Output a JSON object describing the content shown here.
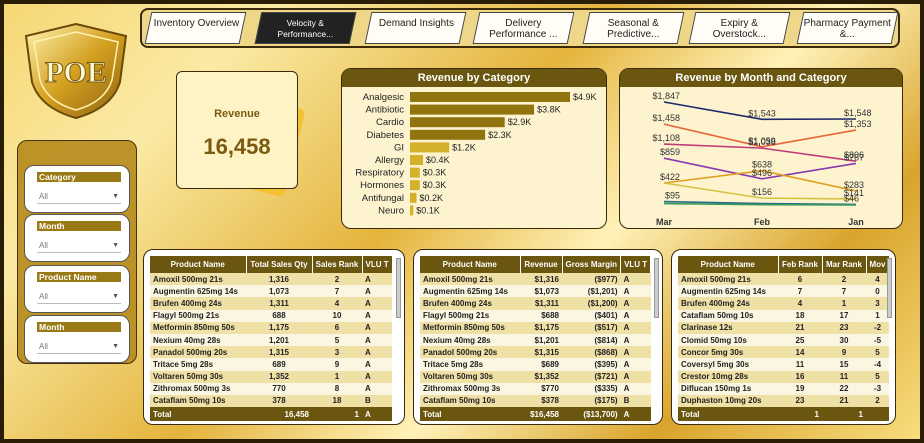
{
  "logo_text": "POE",
  "nav": [
    {
      "label": "Inventory Overview",
      "active": false
    },
    {
      "label": "Velocity & Performance...",
      "active": true
    },
    {
      "label": "Demand Insights",
      "active": false
    },
    {
      "label": "Delivery Performance ...",
      "active": false
    },
    {
      "label": "Seasonal & Predictive...",
      "active": false
    },
    {
      "label": "Expiry & Overstock...",
      "active": false
    },
    {
      "label": "Pharmacy Payment &...",
      "active": false
    }
  ],
  "revenue_card": {
    "label": "Revenue",
    "value": "16,458"
  },
  "slicers": [
    {
      "title": "Category",
      "value": "All"
    },
    {
      "title": "Month",
      "value": "All"
    },
    {
      "title": "Product Name",
      "value": "All"
    },
    {
      "title": "Month",
      "value": "All"
    }
  ],
  "colors": {
    "bar": "#8f7410",
    "bar_light": "#d4b12a",
    "header": "#6b560f"
  },
  "chart_data": [
    {
      "type": "bar",
      "title": "Revenue by Category",
      "categories": [
        "Analgesic",
        "Antibiotic",
        "Cardio",
        "Diabetes",
        "GI",
        "Allergy",
        "Respiratory",
        "Hormones",
        "Antifungal",
        "Neuro"
      ],
      "values": [
        4.9,
        3.8,
        2.9,
        2.3,
        1.2,
        0.4,
        0.3,
        0.3,
        0.2,
        0.1
      ],
      "data_labels": [
        "$4.9K",
        "$3.8K",
        "$2.9K",
        "$2.3K",
        "$1.2K",
        "$0.4K",
        "$0.3K",
        "$0.3K",
        "$0.2K",
        "$0.1K"
      ]
    },
    {
      "type": "line",
      "title": "Revenue by Month and Category",
      "x": [
        "Mar",
        "Feb",
        "Jan"
      ],
      "series": [
        {
          "color": "#1c2a6b",
          "values": [
            1847,
            1543,
            1548
          ]
        },
        {
          "color": "#e8643a",
          "values": [
            1458,
            1059,
            1353
          ]
        },
        {
          "color": "#c03a7a",
          "values": [
            1108,
            1036,
            806
          ]
        },
        {
          "color": "#8a3ab0",
          "values": [
            859,
            496,
            767
          ]
        },
        {
          "color": "#e0a020",
          "values": [
            422,
            638,
            283
          ]
        },
        {
          "color": "#d8c040",
          "values": [
            422,
            156,
            141
          ]
        },
        {
          "color": "#2a6a8a",
          "values": [
            95,
            60,
            46
          ]
        },
        {
          "color": "#3a9a5a",
          "values": [
            60,
            40,
            35
          ]
        }
      ],
      "point_labels": [
        {
          "text": "$1,847",
          "i": 0,
          "v": 1847
        },
        {
          "text": "$1,458",
          "i": 0,
          "v": 1458
        },
        {
          "text": "$1,108",
          "i": 0,
          "v": 1108
        },
        {
          "text": "$859",
          "i": 0,
          "v": 859
        },
        {
          "text": "$422",
          "i": 0,
          "v": 422
        },
        {
          "text": "$95",
          "i": 0,
          "v": 95
        },
        {
          "text": "$1,543",
          "i": 1,
          "v": 1543
        },
        {
          "text": "$1,059",
          "i": 1,
          "v": 1059
        },
        {
          "text": "$1,036",
          "i": 1,
          "v": 1036
        },
        {
          "text": "$496",
          "i": 1,
          "v": 496
        },
        {
          "text": "$638",
          "i": 1,
          "v": 638
        },
        {
          "text": "$156",
          "i": 1,
          "v": 156
        },
        {
          "text": "$1,548",
          "i": 2,
          "v": 1548
        },
        {
          "text": "$1,353",
          "i": 2,
          "v": 1353
        },
        {
          "text": "$806",
          "i": 2,
          "v": 806
        },
        {
          "text": "$767",
          "i": 2,
          "v": 767
        },
        {
          "text": "$283",
          "i": 2,
          "v": 283
        },
        {
          "text": "$141",
          "i": 2,
          "v": 141
        },
        {
          "text": "$46",
          "i": 2,
          "v": 46
        }
      ]
    }
  ],
  "table1": {
    "headers": [
      "Product Name",
      "Total Sales Qty",
      "Sales Rank",
      "VLU T"
    ],
    "rows": [
      [
        "Amoxil 500mg 21s",
        "1,316",
        "2",
        "A"
      ],
      [
        "Augmentin 625mg 14s",
        "1,073",
        "7",
        "A"
      ],
      [
        "Brufen 400mg 24s",
        "1,311",
        "4",
        "A"
      ],
      [
        "Flagyl 500mg 21s",
        "688",
        "10",
        "A"
      ],
      [
        "Metformin 850mg 50s",
        "1,175",
        "6",
        "A"
      ],
      [
        "Nexium 40mg 28s",
        "1,201",
        "5",
        "A"
      ],
      [
        "Panadol 500mg 20s",
        "1,315",
        "3",
        "A"
      ],
      [
        "Tritace 5mg 28s",
        "689",
        "9",
        "A"
      ],
      [
        "Voltaren 50mg 30s",
        "1,352",
        "1",
        "A"
      ],
      [
        "Zithromax 500mg 3s",
        "770",
        "8",
        "A"
      ],
      [
        "Cataflam 50mg 10s",
        "378",
        "18",
        "B"
      ]
    ],
    "total": [
      "Total",
      "16,458",
      "1",
      "A"
    ]
  },
  "table2": {
    "headers": [
      "Product Name",
      "Revenue",
      "Gross Margin",
      "VLU T"
    ],
    "rows": [
      [
        "Amoxil 500mg 21s",
        "$1,316",
        "($977)",
        "A"
      ],
      [
        "Augmentin 625mg 14s",
        "$1,073",
        "($1,201)",
        "A"
      ],
      [
        "Brufen 400mg 24s",
        "$1,311",
        "($1,200)",
        "A"
      ],
      [
        "Flagyl 500mg 21s",
        "$688",
        "($401)",
        "A"
      ],
      [
        "Metformin 850mg 50s",
        "$1,175",
        "($517)",
        "A"
      ],
      [
        "Nexium 40mg 28s",
        "$1,201",
        "($814)",
        "A"
      ],
      [
        "Panadol 500mg 20s",
        "$1,315",
        "($868)",
        "A"
      ],
      [
        "Tritace 5mg 28s",
        "$689",
        "($395)",
        "A"
      ],
      [
        "Voltaren 50mg 30s",
        "$1,352",
        "($721)",
        "A"
      ],
      [
        "Zithromax 500mg 3s",
        "$770",
        "($335)",
        "A"
      ],
      [
        "Cataflam 50mg 10s",
        "$378",
        "($175)",
        "B"
      ]
    ],
    "total": [
      "Total",
      "$16,458",
      "($13,700)",
      "A"
    ]
  },
  "table3": {
    "headers": [
      "Product Name",
      "Feb Rank",
      "Mar Rank",
      "Mov"
    ],
    "rows": [
      [
        "Amoxil 500mg 21s",
        "6",
        "2",
        "4"
      ],
      [
        "Augmentin 625mg 14s",
        "7",
        "7",
        "0"
      ],
      [
        "Brufen 400mg 24s",
        "4",
        "1",
        "3"
      ],
      [
        "Cataflam 50mg 10s",
        "18",
        "17",
        "1"
      ],
      [
        "Clarinase 12s",
        "21",
        "23",
        "-2"
      ],
      [
        "Clomid 50mg 10s",
        "25",
        "30",
        "-5"
      ],
      [
        "Concor 5mg 30s",
        "14",
        "9",
        "5"
      ],
      [
        "Coversyl 5mg 30s",
        "11",
        "15",
        "-4"
      ],
      [
        "Crestor 10mg 28s",
        "16",
        "11",
        "5"
      ],
      [
        "Diflucan 150mg 1s",
        "19",
        "22",
        "-3"
      ],
      [
        "Duphaston 10mg 20s",
        "23",
        "21",
        "2"
      ]
    ],
    "total": [
      "Total",
      "1",
      "1",
      ""
    ]
  }
}
